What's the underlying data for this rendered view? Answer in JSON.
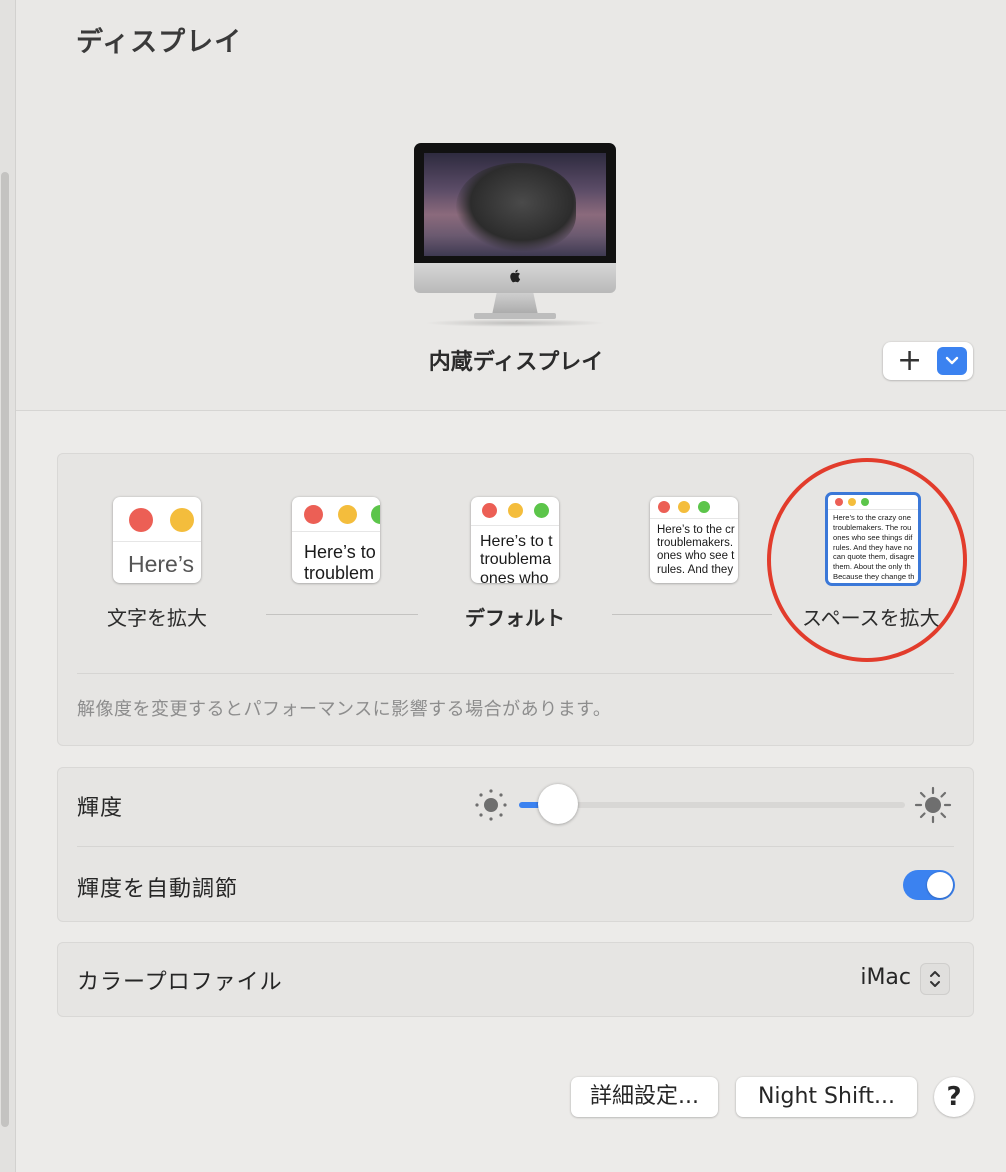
{
  "page": {
    "title": "ディスプレイ"
  },
  "display": {
    "name": "内蔵ディスプレイ",
    "add_button": "+"
  },
  "resolution": {
    "label_left": "文字を拡大",
    "label_center": "デフォルト",
    "label_right": "スペースを拡大",
    "note": "解像度を変更するとパフォーマンスに影響する場合があります。",
    "selected_index": 4,
    "thumbnails": [
      {
        "text": "Here’s"
      },
      {
        "text": "Here’s to\ntroublem"
      },
      {
        "text": "Here’s to t\ntroublema\nones who"
      },
      {
        "text": "Here’s to the cr\ntroublemakers.\nones who see t\nrules. And they"
      },
      {
        "text": "Here’s to the crazy one\ntroublemakers. The rou\nones who see things dif\nrules. And they have no\ncan quote them, disagre\nthem. About the only th\nBecause they change th"
      }
    ]
  },
  "brightness": {
    "label": "輝度",
    "level": 0.1,
    "auto_label": "輝度を自動調節",
    "auto_enabled": true
  },
  "color_profile": {
    "label": "カラープロファイル",
    "value": "iMac"
  },
  "buttons": {
    "advanced": "詳細設定...",
    "night_shift": "Night Shift...",
    "help": "?"
  },
  "colors": {
    "accent": "#3b82f0",
    "highlight_circle": "#e23c2c",
    "traffic_red": "#ec5f55",
    "traffic_yellow": "#f4bd3c",
    "traffic_green": "#5cc54a"
  }
}
